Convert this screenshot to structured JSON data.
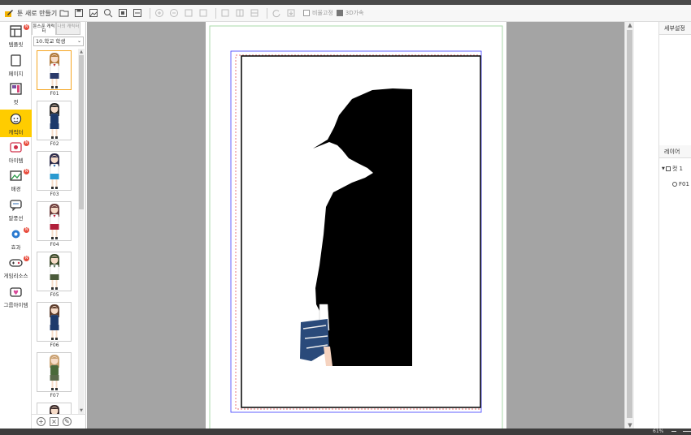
{
  "toolbar": {
    "new_toon_label": "툰 새로 만들기",
    "options": [
      {
        "label": "비율고정",
        "checked": false
      },
      {
        "label": "3D가속",
        "checked": true
      }
    ]
  },
  "nav": {
    "items": [
      {
        "label": "템플릿",
        "icon": "template-icon",
        "badge": "N"
      },
      {
        "label": "페이지",
        "icon": "page-icon",
        "badge": ""
      },
      {
        "label": "컷",
        "icon": "cut-icon",
        "badge": ""
      },
      {
        "label": "캐릭터",
        "icon": "character-icon",
        "badge": "",
        "active": true
      },
      {
        "label": "아이템",
        "icon": "item-icon",
        "badge": "N"
      },
      {
        "label": "배경",
        "icon": "background-icon",
        "badge": "N"
      },
      {
        "label": "말풍선",
        "icon": "speech-bubble-icon",
        "badge": ""
      },
      {
        "label": "효과",
        "icon": "effect-icon",
        "badge": "N"
      },
      {
        "label": "게임리소스",
        "icon": "gamepad-icon",
        "badge": "N"
      },
      {
        "label": "그룹아이템",
        "icon": "group-item-icon",
        "badge": ""
      }
    ]
  },
  "character_panel": {
    "tabs": [
      {
        "label": "툰스푼 캐릭터",
        "active": true
      },
      {
        "label": "나의 캐릭터",
        "active": false
      }
    ],
    "category": "10.학교 학생",
    "characters": [
      {
        "name": "F01",
        "hair": "#b07838",
        "outfit": "#ffffff",
        "accent": "#c43030",
        "skirt": "#2a3a6a"
      },
      {
        "name": "F02",
        "hair": "#2a2a2a",
        "outfit": "#1d3a6b",
        "accent": "#1d3a6b",
        "skirt": "#1d3a6b"
      },
      {
        "name": "F03",
        "hair": "#2a2a4a",
        "outfit": "#ffffff",
        "accent": "#2a6ab0",
        "skirt": "#2a9ad0"
      },
      {
        "name": "F04",
        "hair": "#6a3a3a",
        "outfit": "#ffffff",
        "accent": "#c41e3a",
        "skirt": "#b01e3a"
      },
      {
        "name": "F05",
        "hair": "#3a4a2a",
        "outfit": "#ffffff",
        "accent": "#3a5a3a",
        "skirt": "#4a5a3a"
      },
      {
        "name": "F06",
        "hair": "#5a3a2a",
        "outfit": "#1d3a6b",
        "accent": "#1d3a6b",
        "skirt": "#1d3a6b"
      },
      {
        "name": "F07",
        "hair": "#c8a070",
        "outfit": "#4a6a3a",
        "accent": "#4a6a3a",
        "skirt": "#5a6a4a"
      },
      {
        "name": "",
        "hair": "#3a2a2a",
        "outfit": "#ffffff",
        "accent": "#777777",
        "skirt": "#777777"
      }
    ]
  },
  "right_panel": {
    "details_title": "세부설정",
    "layers_title": "레이어",
    "layers": [
      {
        "label": "컷 1",
        "level": 0
      },
      {
        "label": "F01",
        "level": 1
      }
    ]
  },
  "status": {
    "zoom": "61%"
  }
}
